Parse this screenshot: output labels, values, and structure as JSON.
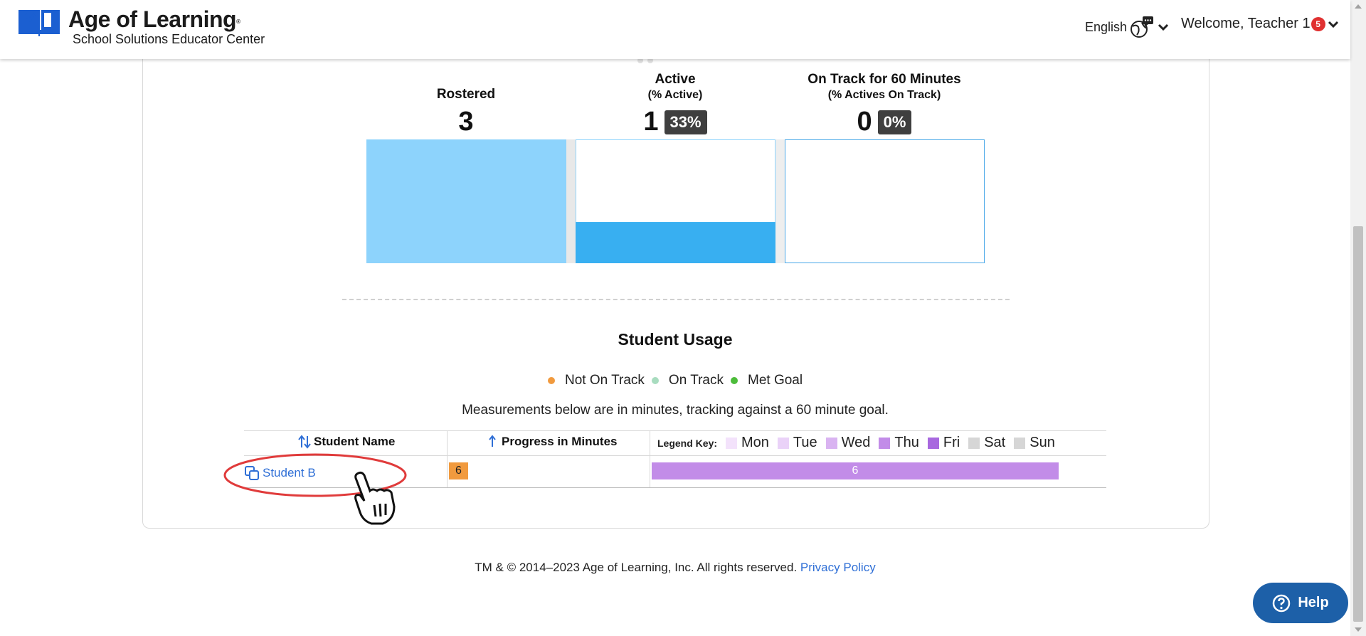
{
  "header": {
    "brand": "Age of Learning",
    "brand_mark": "®",
    "subtitle": "School Solutions Educator Center",
    "language_label": "English",
    "welcome_label": "Welcome, Teacher 1",
    "notification_count": "5"
  },
  "funnel": {
    "rostered": {
      "title": "Rostered",
      "value": "3"
    },
    "active": {
      "title": "Active",
      "subtitle": "(% Active)",
      "value": "1",
      "percent": "33%",
      "fill_fraction": 0.333
    },
    "on_track": {
      "title": "On Track for 60 Minutes",
      "subtitle": "(% Actives On Track)",
      "value": "0",
      "percent": "0%",
      "fill_fraction": 0
    },
    "colors": {
      "light": "#8dd3fc",
      "medium": "#38aff1",
      "border": "#4aa8e8"
    }
  },
  "usage": {
    "title": "Student Usage",
    "legend": [
      {
        "label": "Not On Track",
        "color": "#f19a3e"
      },
      {
        "label": "On Track",
        "color": "#a8dcbf"
      },
      {
        "label": "Met Goal",
        "color": "#4cbc3a"
      }
    ],
    "measurement_note": "Measurements below are in minutes, tracking against a 60 minute goal.",
    "columns": {
      "student_name": "Student Name",
      "progress": "Progress in Minutes",
      "legend_key": "Legend Key:"
    },
    "day_legend": [
      {
        "label": "Mon",
        "color": "#f3e2fb"
      },
      {
        "label": "Tue",
        "color": "#ead2f8"
      },
      {
        "label": "Wed",
        "color": "#d9b3f1"
      },
      {
        "label": "Thu",
        "color": "#c28ce8"
      },
      {
        "label": "Fri",
        "color": "#a868df"
      },
      {
        "label": "Sat",
        "color": "#d6d6d6"
      },
      {
        "label": "Sun",
        "color": "#d6d6d6"
      }
    ],
    "rows": [
      {
        "name": "Student B",
        "progress": "6",
        "thu_minutes": "6"
      }
    ]
  },
  "footer": {
    "copyright": "TM & © 2014–2023 Age of Learning, Inc. All rights reserved.",
    "privacy_link": "Privacy Policy"
  },
  "help": {
    "label": "Help"
  }
}
